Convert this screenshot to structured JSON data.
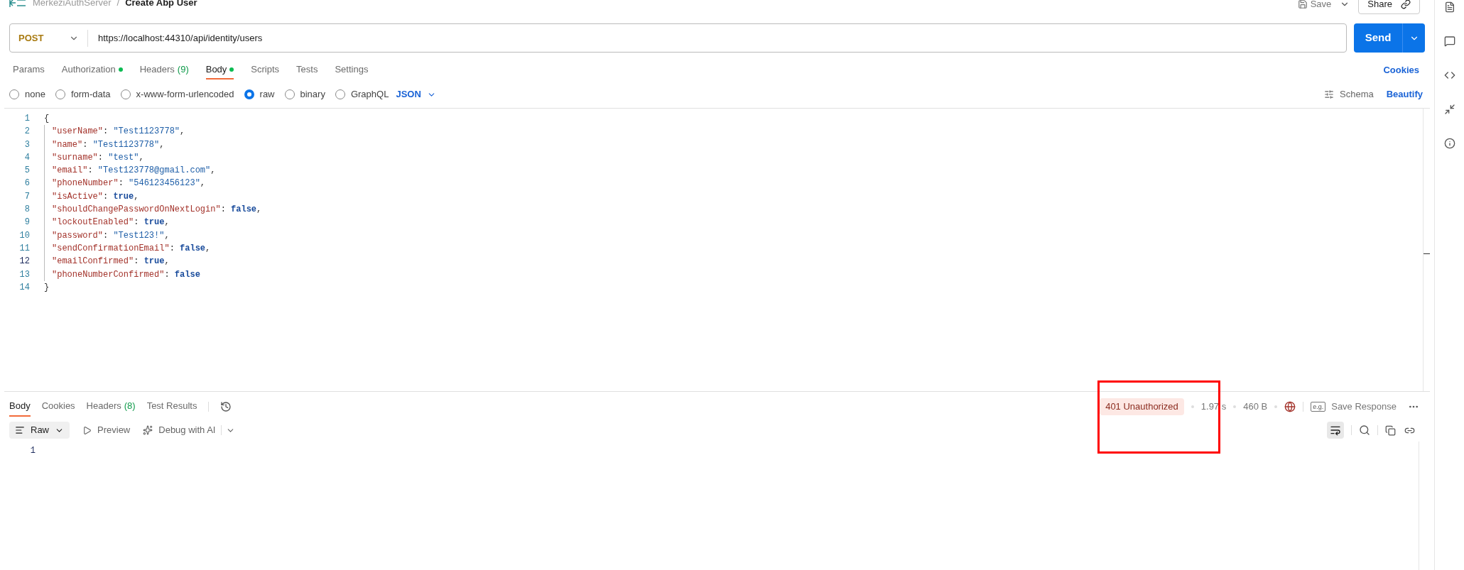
{
  "breadcrumb": {
    "collection": "MerkeziAuthServer",
    "separator": "/",
    "request": "Create Abp User"
  },
  "header_actions": {
    "save": "Save",
    "share": "Share"
  },
  "request": {
    "method": "POST",
    "url": "https://localhost:44310/api/identity/users",
    "send": "Send"
  },
  "tabs": [
    {
      "label": "Params",
      "dot": false,
      "selected": false
    },
    {
      "label": "Authorization",
      "dot": true,
      "selected": false
    },
    {
      "label": "Headers",
      "count": "(9)",
      "dot": false,
      "selected": false
    },
    {
      "label": "Body",
      "dot": true,
      "selected": true
    },
    {
      "label": "Scripts",
      "dot": false,
      "selected": false
    },
    {
      "label": "Tests",
      "dot": false,
      "selected": false
    },
    {
      "label": "Settings",
      "dot": false,
      "selected": false
    }
  ],
  "cookies_link": "Cookies",
  "body_types": [
    {
      "label": "none",
      "selected": false
    },
    {
      "label": "form-data",
      "selected": false
    },
    {
      "label": "x-www-form-urlencoded",
      "selected": false
    },
    {
      "label": "raw",
      "selected": true
    },
    {
      "label": "binary",
      "selected": false
    },
    {
      "label": "GraphQL",
      "selected": false
    }
  ],
  "language": "JSON",
  "schema": "Schema",
  "beautify": "Beautify",
  "code_lines": [
    {
      "number": "1",
      "active": false,
      "tokens": [
        {
          "kind": "punct",
          "text": "{"
        }
      ]
    },
    {
      "number": "2",
      "active": false,
      "tokens": [
        {
          "kind": "key",
          "text": "\"userName\""
        },
        {
          "kind": "punct",
          "text": ": "
        },
        {
          "kind": "string",
          "text": "\"Test1123778\""
        },
        {
          "kind": "punct",
          "text": ","
        }
      ]
    },
    {
      "number": "3",
      "active": false,
      "tokens": [
        {
          "kind": "key",
          "text": "\"name\""
        },
        {
          "kind": "punct",
          "text": ": "
        },
        {
          "kind": "string",
          "text": "\"Test1123778\""
        },
        {
          "kind": "punct",
          "text": ","
        }
      ]
    },
    {
      "number": "4",
      "active": false,
      "tokens": [
        {
          "kind": "key",
          "text": "\"surname\""
        },
        {
          "kind": "punct",
          "text": ": "
        },
        {
          "kind": "string",
          "text": "\"test\""
        },
        {
          "kind": "punct",
          "text": ","
        }
      ]
    },
    {
      "number": "5",
      "active": false,
      "tokens": [
        {
          "kind": "key",
          "text": "\"email\""
        },
        {
          "kind": "punct",
          "text": ": "
        },
        {
          "kind": "string",
          "text": "\"Test123778@gmail.com\""
        },
        {
          "kind": "punct",
          "text": ","
        }
      ]
    },
    {
      "number": "6",
      "active": false,
      "tokens": [
        {
          "kind": "key",
          "text": "\"phoneNumber\""
        },
        {
          "kind": "punct",
          "text": ": "
        },
        {
          "kind": "string",
          "text": "\"546123456123\""
        },
        {
          "kind": "punct",
          "text": ","
        }
      ]
    },
    {
      "number": "7",
      "active": false,
      "tokens": [
        {
          "kind": "key",
          "text": "\"isActive\""
        },
        {
          "kind": "punct",
          "text": ": "
        },
        {
          "kind": "keyword",
          "text": "true"
        },
        {
          "kind": "punct",
          "text": ","
        }
      ]
    },
    {
      "number": "8",
      "active": false,
      "tokens": [
        {
          "kind": "key",
          "text": "\"shouldChangePasswordOnNextLogin\""
        },
        {
          "kind": "punct",
          "text": ": "
        },
        {
          "kind": "keyword",
          "text": "false"
        },
        {
          "kind": "punct",
          "text": ","
        }
      ]
    },
    {
      "number": "9",
      "active": false,
      "tokens": [
        {
          "kind": "key",
          "text": "\"lockoutEnabled\""
        },
        {
          "kind": "punct",
          "text": ": "
        },
        {
          "kind": "keyword",
          "text": "true"
        },
        {
          "kind": "punct",
          "text": ","
        }
      ]
    },
    {
      "number": "10",
      "active": false,
      "tokens": [
        {
          "kind": "key",
          "text": "\"password\""
        },
        {
          "kind": "punct",
          "text": ": "
        },
        {
          "kind": "string",
          "text": "\"Test123!\""
        },
        {
          "kind": "punct",
          "text": ","
        }
      ]
    },
    {
      "number": "11",
      "active": false,
      "tokens": [
        {
          "kind": "key",
          "text": "\"sendConfirmationEmail\""
        },
        {
          "kind": "punct",
          "text": ": "
        },
        {
          "kind": "keyword",
          "text": "false"
        },
        {
          "kind": "punct",
          "text": ","
        }
      ]
    },
    {
      "number": "12",
      "active": true,
      "tokens": [
        {
          "kind": "key",
          "text": "\"emailConfirmed\""
        },
        {
          "kind": "punct",
          "text": ": "
        },
        {
          "kind": "keyword",
          "text": "true"
        },
        {
          "kind": "punct",
          "text": ","
        }
      ]
    },
    {
      "number": "13",
      "active": false,
      "tokens": [
        {
          "kind": "key",
          "text": "\"phoneNumberConfirmed\""
        },
        {
          "kind": "punct",
          "text": ": "
        },
        {
          "kind": "keyword",
          "text": "false"
        }
      ]
    },
    {
      "number": "14",
      "active": false,
      "tokens": [
        {
          "kind": "punct",
          "text": "}"
        }
      ]
    }
  ],
  "response_tabs": [
    {
      "label": "Body",
      "selected": true
    },
    {
      "label": "Cookies",
      "selected": false
    },
    {
      "label": "Headers",
      "count": "(8)",
      "selected": false
    },
    {
      "label": "Test Results",
      "selected": false
    }
  ],
  "response_status": {
    "status": "401 Unauthorized",
    "time": "1.97 s",
    "size": "460 B",
    "save_icon_text": "e.g.",
    "save_response": "Save Response"
  },
  "response_view": {
    "format": "Raw",
    "preview": "Preview",
    "debug": "Debug with AI"
  },
  "response_lines": [
    "1"
  ]
}
